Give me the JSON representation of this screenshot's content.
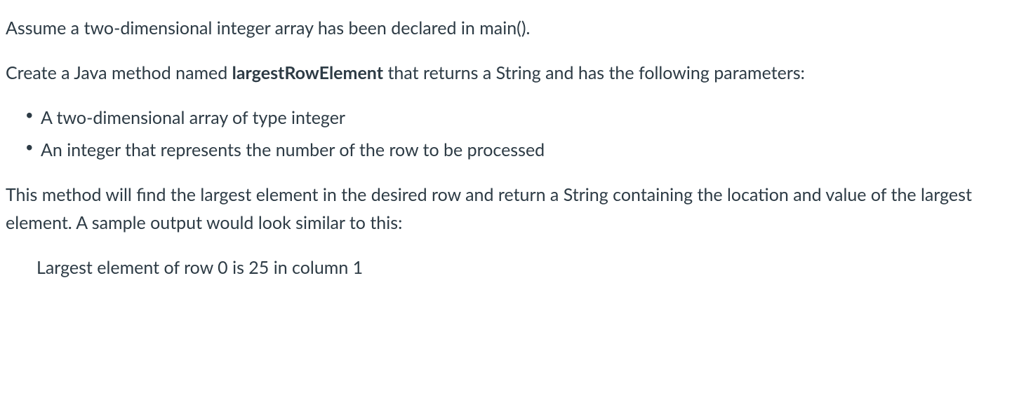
{
  "para1": "Assume a two-dimensional integer array has been declared in main().",
  "para2_pre": "Create a Java method named ",
  "para2_method": "largestRowElement",
  "para2_post": " that returns a String and has the following parameters:",
  "bullets": [
    "A two-dimensional array of type integer",
    "An integer that represents the number of the row to be processed"
  ],
  "para3": "This method will find the largest element in the desired row and return a String containing the location and value of the largest element. A sample output would look similar to this:",
  "sample_output": "Largest element of row 0 is 25 in column 1"
}
